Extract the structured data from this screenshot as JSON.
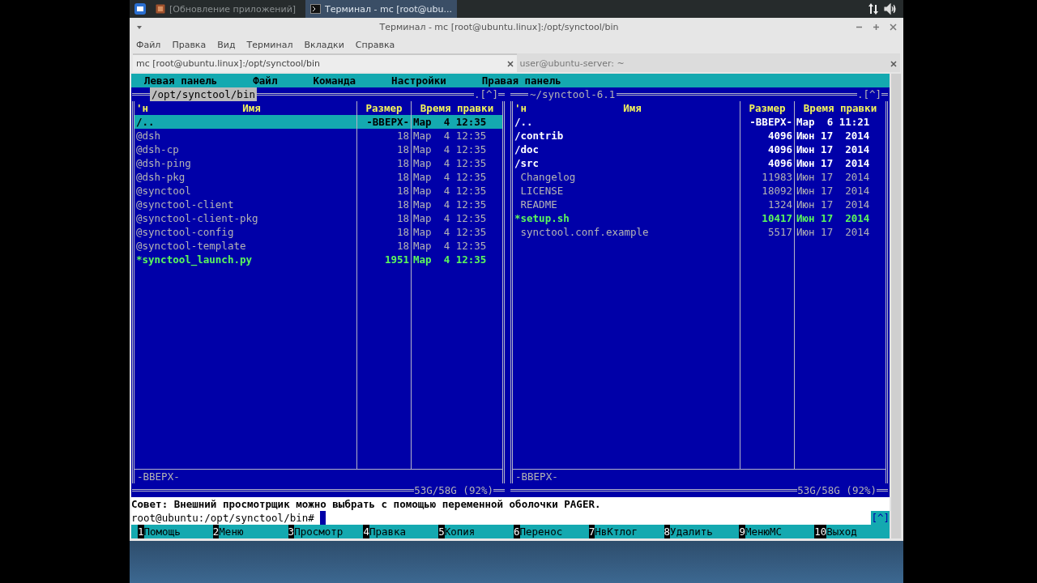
{
  "taskbar": {
    "tasks": [
      {
        "label": "[Обновление приложений]",
        "kind": "updates",
        "selected": false
      },
      {
        "label": "Терминал - mc [root@ubu...",
        "kind": "terminal",
        "selected": true
      }
    ]
  },
  "window": {
    "title": "Терминал - mc [root@ubuntu.linux]:/opt/synctool/bin",
    "menu": [
      "Файл",
      "Правка",
      "Вид",
      "Терминал",
      "Вкладки",
      "Справка"
    ],
    "tabs": [
      {
        "label": "mc [root@ubuntu.linux]:/opt/synctool/bin",
        "selected": true
      },
      {
        "label": "user@ubuntu-server: ~",
        "selected": false
      }
    ]
  },
  "mc": {
    "menubar": [
      "Левая панель",
      "Файл",
      "Команда",
      "Настройки",
      "Правая панель"
    ],
    "panels": [
      {
        "path": "/opt/synctool/bin",
        "selected": true,
        "scroll_mark": ".[^]",
        "sort_mark": "'н",
        "columns": [
          "Имя",
          "Размер",
          "Время правки"
        ],
        "rows": [
          {
            "name": "/..",
            "size": "-ВВЕРХ-",
            "date": "Мар  4 12:35",
            "kind": "dir",
            "selected": true
          },
          {
            "name": "@dsh",
            "size": "18",
            "date": "Мар  4 12:35",
            "kind": "file",
            "selected": false
          },
          {
            "name": "@dsh-cp",
            "size": "18",
            "date": "Мар  4 12:35",
            "kind": "file",
            "selected": false
          },
          {
            "name": "@dsh-ping",
            "size": "18",
            "date": "Мар  4 12:35",
            "kind": "file",
            "selected": false
          },
          {
            "name": "@dsh-pkg",
            "size": "18",
            "date": "Мар  4 12:35",
            "kind": "file",
            "selected": false
          },
          {
            "name": "@synctool",
            "size": "18",
            "date": "Мар  4 12:35",
            "kind": "file",
            "selected": false
          },
          {
            "name": "@synctool-client",
            "size": "18",
            "date": "Мар  4 12:35",
            "kind": "file",
            "selected": false
          },
          {
            "name": "@synctool-client-pkg",
            "size": "18",
            "date": "Мар  4 12:35",
            "kind": "file",
            "selected": false
          },
          {
            "name": "@synctool-config",
            "size": "18",
            "date": "Мар  4 12:35",
            "kind": "file",
            "selected": false
          },
          {
            "name": "@synctool-template",
            "size": "18",
            "date": "Мар  4 12:35",
            "kind": "file",
            "selected": false
          },
          {
            "name": "*synctool_launch.py",
            "size": "1951",
            "date": "Мар  4 12:35",
            "kind": "exec",
            "selected": false
          }
        ],
        "status": "-ВВЕРХ-",
        "disk": "53G/58G (92%)"
      },
      {
        "path": "~/synctool-6.1",
        "selected": false,
        "scroll_mark": ".[^]",
        "sort_mark": "'н",
        "columns": [
          "Имя",
          "Размер",
          "Время правки"
        ],
        "rows": [
          {
            "name": "/..",
            "size": "-ВВЕРХ-",
            "date": "Мар  6 11:21",
            "kind": "dir",
            "selected": false
          },
          {
            "name": "/contrib",
            "size": "4096",
            "date": "Июн 17  2014",
            "kind": "dir",
            "selected": false
          },
          {
            "name": "/doc",
            "size": "4096",
            "date": "Июн 17  2014",
            "kind": "dir",
            "selected": false
          },
          {
            "name": "/src",
            "size": "4096",
            "date": "Июн 17  2014",
            "kind": "dir",
            "selected": false
          },
          {
            "name": " Changelog",
            "size": "11983",
            "date": "Июн 17  2014",
            "kind": "file",
            "selected": false
          },
          {
            "name": " LICENSE",
            "size": "18092",
            "date": "Июн 17  2014",
            "kind": "file",
            "selected": false
          },
          {
            "name": " README",
            "size": "1324",
            "date": "Июн 17  2014",
            "kind": "file",
            "selected": false
          },
          {
            "name": "*setup.sh",
            "size": "10417",
            "date": "Июн 17  2014",
            "kind": "exec",
            "selected": false
          },
          {
            "name": " synctool.conf.example",
            "size": "5517",
            "date": "Июн 17  2014",
            "kind": "file",
            "selected": false
          }
        ],
        "status": "-ВВЕРХ-",
        "disk": "53G/58G (92%)"
      }
    ],
    "hint": "Совет: Внешний просмотрщик можно выбрать с помощью переменной оболочки PAGER.",
    "prompt": "root@ubuntu:/opt/synctool/bin#",
    "prompt_mark": "[^]",
    "fkeys": [
      {
        "num": "1",
        "label": "Помощь"
      },
      {
        "num": "2",
        "label": "Меню"
      },
      {
        "num": "3",
        "label": "Просмотр"
      },
      {
        "num": "4",
        "label": "Правка"
      },
      {
        "num": "5",
        "label": "Копия"
      },
      {
        "num": "6",
        "label": "Перенос"
      },
      {
        "num": "7",
        "label": "НвКтлог"
      },
      {
        "num": "8",
        "label": "Удалить"
      },
      {
        "num": "9",
        "label": "МенюМС"
      },
      {
        "num": "10",
        "label": "Выход"
      }
    ]
  }
}
